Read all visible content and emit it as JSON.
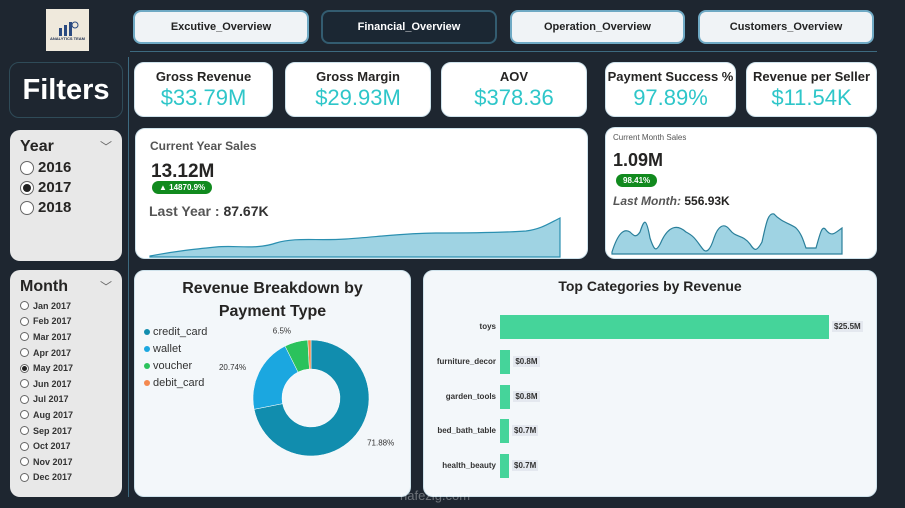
{
  "logo": {
    "text": "ANALYTICS TEAM"
  },
  "tabs": [
    {
      "label": "Excutive_Overview",
      "active": false
    },
    {
      "label": "Financial_Overview",
      "active": true
    },
    {
      "label": "Operation_Overview",
      "active": false
    },
    {
      "label": "Customers_Overview",
      "active": false
    }
  ],
  "filters_title": "Filters",
  "year_slicer": {
    "title": "Year",
    "options": [
      "2016",
      "2017",
      "2018"
    ],
    "selected": "2017"
  },
  "month_slicer": {
    "title": "Month",
    "options": [
      "Jan 2017",
      "Feb 2017",
      "Mar 2017",
      "Apr 2017",
      "May 2017",
      "Jun 2017",
      "Jul 2017",
      "Aug 2017",
      "Sep 2017",
      "Oct 2017",
      "Nov 2017",
      "Dec 2017"
    ],
    "selected": "May 2017"
  },
  "kpis": [
    {
      "title": "Gross Revenue",
      "value": "$33.79M"
    },
    {
      "title": "Gross Margin",
      "value": "$29.93M"
    },
    {
      "title": "AOV",
      "value": "$378.36"
    },
    {
      "title": "Payment Success %",
      "value": "97.89%"
    },
    {
      "title": "Revenue per Seller",
      "value": "$11.54K"
    }
  ],
  "current_year": {
    "title": "Current Year Sales",
    "value": "13.12M",
    "change": "▲ 14870.9%",
    "last_label": "Last Year : ",
    "last_value": "87.67K"
  },
  "current_month": {
    "title": "Current Month Sales",
    "value": "1.09M",
    "change": "98.41%",
    "last_label": "Last Month:",
    "last_value": "556.93K"
  },
  "colors": {
    "accent": "#2ec6c9",
    "badge": "#118a1e",
    "area": "#9fd3e3",
    "bar": "#45d49a"
  },
  "chart_data": [
    {
      "type": "pie",
      "title": "Revenue Breakdown by Payment Type",
      "categories": [
        "credit_card",
        "wallet",
        "voucher",
        "debit_card"
      ],
      "values": [
        71.88,
        20.74,
        6.5,
        0.88
      ],
      "labels": [
        "71.88%",
        "20.74%",
        "6.5%",
        ""
      ],
      "colors": [
        "#118dae",
        "#1ba7e0",
        "#2bc25c",
        "#f4894f"
      ],
      "legend": "top-left",
      "donut": true
    },
    {
      "type": "bar",
      "orientation": "horizontal",
      "title": "Top Categories by Revenue",
      "categories": [
        "toys",
        "furniture_decor",
        "garden_tools",
        "bed_bath_table",
        "health_beauty"
      ],
      "values": [
        25.5,
        0.8,
        0.8,
        0.7,
        0.7
      ],
      "labels": [
        "$25.5M",
        "$0.8M",
        "$0.8M",
        "$0.7M",
        "$0.7M"
      ]
    }
  ],
  "watermark": "nafezig.com"
}
